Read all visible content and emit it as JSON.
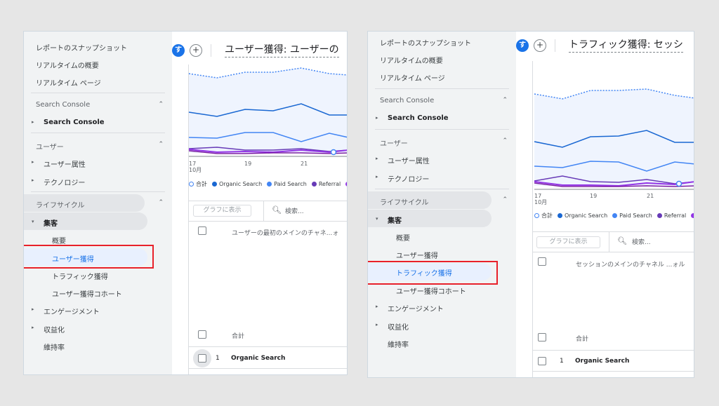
{
  "left": {
    "sidebar": {
      "items": [
        "レポートのスナップショット",
        "リアルタイムの概要",
        "リアルタイム ページ"
      ],
      "search_console_header": "Search Console",
      "search_console_item": "Search Console",
      "user_header": "ユーザー",
      "user_attributes": "ユーザー属性",
      "technology": "テクノロジー",
      "lifecycle_header": "ライフサイクル",
      "acquisition": "集客",
      "overview": "概要",
      "user_acquisition": "ユーザー獲得",
      "traffic_acquisition": "トラフィック獲得",
      "user_acquisition_cohort": "ユーザー獲得コホート",
      "engagement": "エンゲージメント",
      "monetization": "収益化",
      "retention": "維持率"
    },
    "header": {
      "avatar_letter": "す",
      "plus": "+",
      "title": "ユーザー獲得: ユーザーの"
    },
    "toolbar": {
      "graph_button": "グラフに表示",
      "search_placeholder": "検索..."
    },
    "table": {
      "column_header": "ユーザーの最初のメインのチャネ...ォ",
      "total_label": "合計",
      "rows": [
        {
          "index": "1",
          "channel": "Organic Search"
        }
      ]
    }
  },
  "right": {
    "sidebar": {
      "items": [
        "レポートのスナップショット",
        "リアルタイムの概要",
        "リアルタイム ページ"
      ],
      "search_console_header": "Search Console",
      "search_console_item": "Search Console",
      "user_header": "ユーザー",
      "user_attributes": "ユーザー属性",
      "technology": "テクノロジー",
      "lifecycle_header": "ライフサイクル",
      "acquisition": "集客",
      "overview": "概要",
      "user_acquisition": "ユーザー獲得",
      "traffic_acquisition": "トラフィック獲得",
      "user_acquisition_cohort": "ユーザー獲得コホート",
      "engagement": "エンゲージメント",
      "monetization": "収益化",
      "retention": "維持率"
    },
    "header": {
      "avatar_letter": "す",
      "plus": "+",
      "title": "トラフィック獲得: セッシ"
    },
    "toolbar": {
      "graph_button": "グラフに表示",
      "search_placeholder": "検索..."
    },
    "table": {
      "column_header": "セッションのメインのチャネル ...ォル",
      "total_label": "合計",
      "rows": [
        {
          "index": "1",
          "channel": "Organic Search"
        }
      ]
    }
  },
  "chart_data": {
    "type": "line",
    "x_ticks": [
      "17\n10月",
      "19",
      "21"
    ],
    "legend": [
      "合計",
      "Organic Search",
      "Paid Search",
      "Referral"
    ],
    "colors": {
      "total": "#4285f4",
      "organic": "#1967d2",
      "paid": "#4285f4",
      "referral": "#673ab7",
      "other": "#9334e6",
      "highlight": "#e8212a"
    }
  },
  "icons": {
    "search": "search-icon",
    "expand": "chevron-up-icon",
    "collapsed": "triangle-right-icon",
    "expanded": "triangle-down-icon"
  }
}
